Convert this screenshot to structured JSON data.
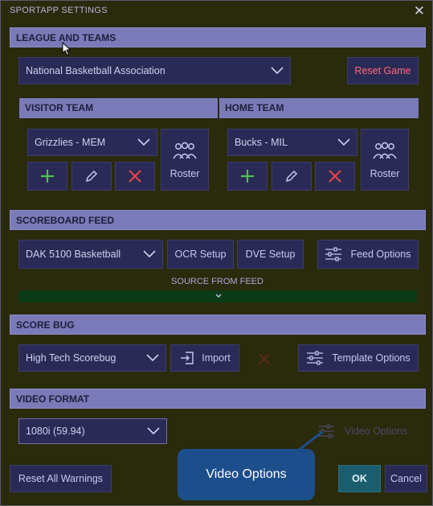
{
  "window": {
    "title": "SPORTAPP SETTINGS"
  },
  "league": {
    "section_title": "LEAGUE AND TEAMS",
    "selected": "National Basketball Association",
    "reset_game_label": "Reset Game"
  },
  "visitor": {
    "header": "VISITOR TEAM",
    "team": "Grizzlies - MEM",
    "roster_label": "Roster"
  },
  "home": {
    "header": "HOME TEAM",
    "team": "Bucks - MIL",
    "roster_label": "Roster"
  },
  "feed": {
    "section_title": "SCOREBOARD FEED",
    "selected": "DAK 5100 Basketball",
    "ocr_label": "OCR Setup",
    "dve_label": "DVE Setup",
    "options_label": "Feed Options",
    "source_label": "SOURCE FROM FEED"
  },
  "scorebug": {
    "section_title": "SCORE BUG",
    "selected": "High Tech Scorebug",
    "import_label": "Import",
    "template_options_label": "Template Options"
  },
  "video": {
    "section_title": "VIDEO FORMAT",
    "selected": "1080i (59.94)",
    "options_label": "Video Options"
  },
  "footer": {
    "reset_warnings_label": "Reset All Warnings",
    "ok_label": "OK",
    "cancel_label": "Cancel"
  },
  "tooltip": {
    "text": "Video Options"
  },
  "colors": {
    "background": "#2a2a0c",
    "section": "#7a7ab8",
    "button": "#2a2a56",
    "accent_red": "#e04848",
    "accent_green": "#4fc04f",
    "ok_teal": "#1a5e6e",
    "tooltip": "#1d4e8c"
  }
}
